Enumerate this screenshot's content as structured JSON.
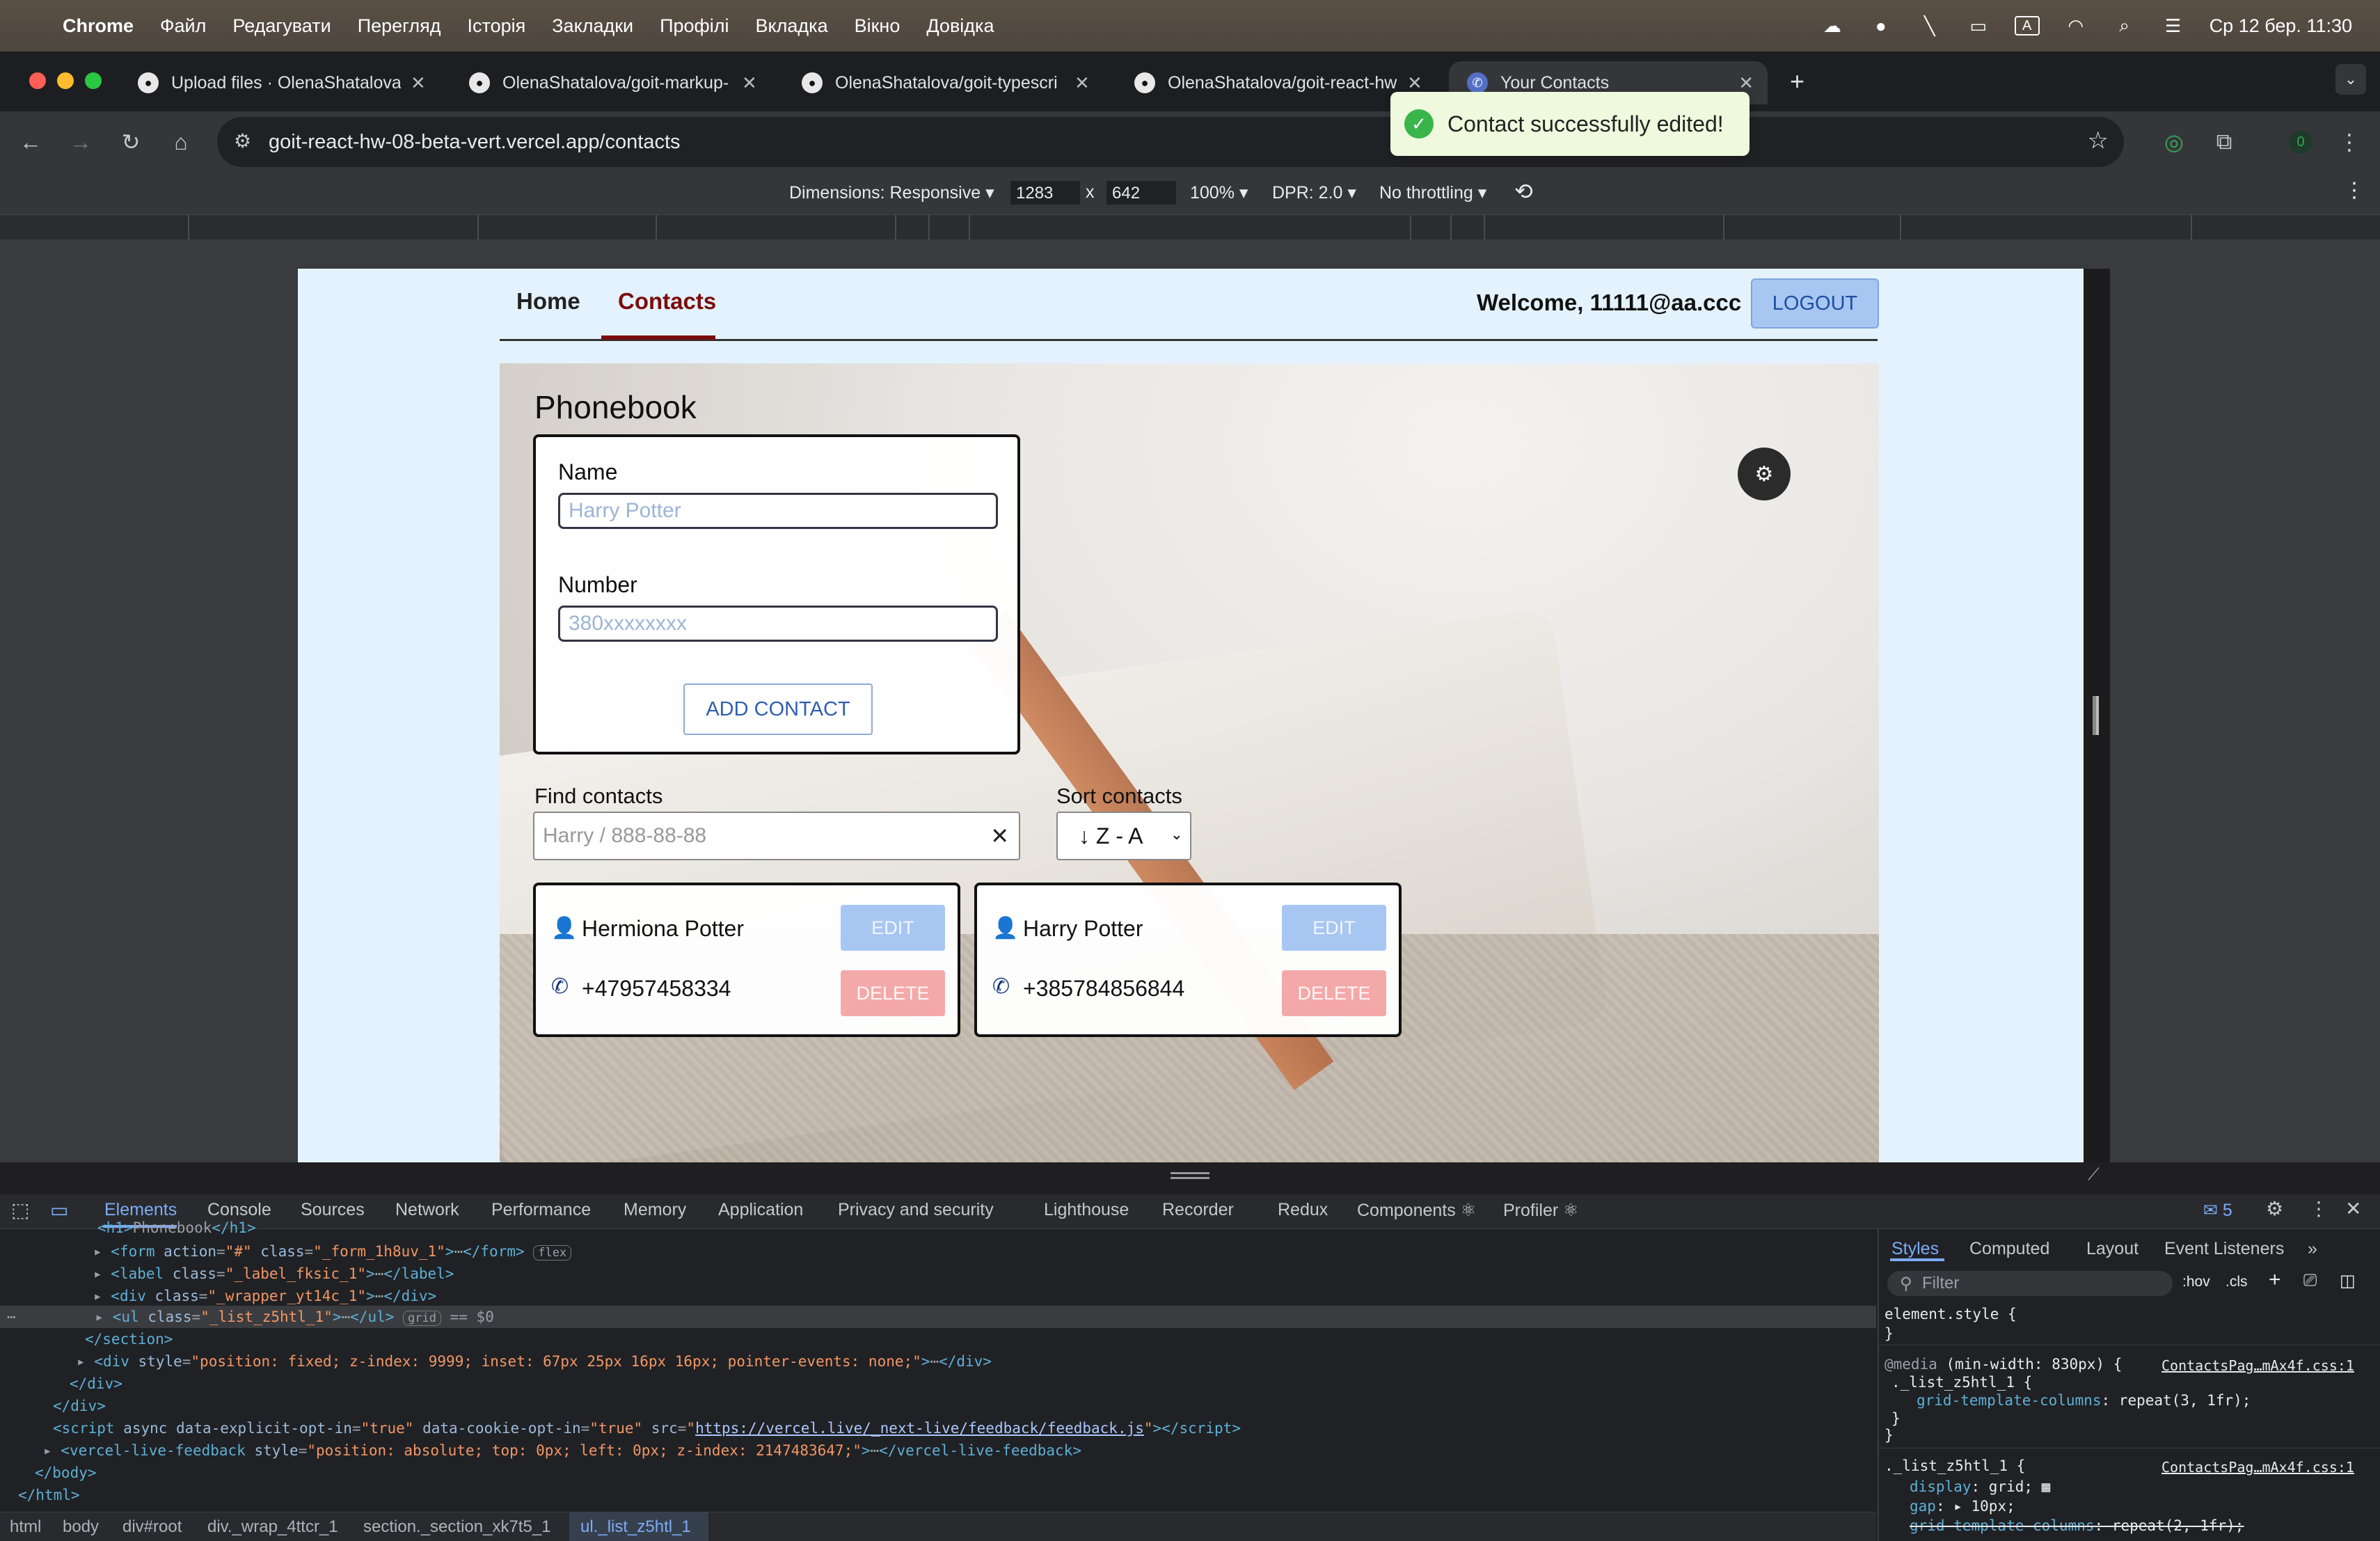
{
  "menubar": {
    "apple": "",
    "app": "Chrome",
    "items": [
      "Файл",
      "Редагувати",
      "Перегляд",
      "Історія",
      "Закладки",
      "Профілі",
      "Вкладка",
      "Вікно",
      "Довідка"
    ],
    "keyboard": "A",
    "datetime": "Ср 12 бер.  11:30"
  },
  "tabs": [
    {
      "title": "Upload files · OlenaShatalova/",
      "icon": "github-icon"
    },
    {
      "title": "OlenaShatalova/goit-markup-",
      "icon": "github-icon"
    },
    {
      "title": "OlenaShatalova/goit-typescri",
      "icon": "github-icon"
    },
    {
      "title": "OlenaShatalova/goit-react-hw",
      "icon": "github-icon"
    },
    {
      "title": "Your Contacts",
      "icon": "phone-icon",
      "active": true
    }
  ],
  "address": {
    "url": "goit-react-hw-08-beta-vert.vercel.app/contacts"
  },
  "extension_badge": "0",
  "device_toolbar": {
    "dimensions_label": "Dimensions: Responsive",
    "width": "1283",
    "times": "x",
    "height": "642",
    "zoom": "100%",
    "dpr": "DPR: 2.0",
    "throttling": "No throttling"
  },
  "app": {
    "nav": {
      "home": "Home",
      "contacts": "Contacts"
    },
    "welcome": "Welcome, 11111@aa.ccc",
    "logout": "LOGOUT",
    "title": "Phonebook",
    "form": {
      "name_label": "Name",
      "name_placeholder": "Harry Potter",
      "number_label": "Number",
      "number_placeholder": "380xxxxxxxx",
      "add_button": "ADD CONTACT"
    },
    "find_label": "Find contacts",
    "find_placeholder": "Harry / 888-88-88",
    "sort_label": "Sort contacts",
    "sort_value": "↓ Z - A",
    "contacts": [
      {
        "name": "Hermiona Potter",
        "number": "+47957458334",
        "edit": "EDIT",
        "delete": "DELETE"
      },
      {
        "name": "Harry Potter",
        "number": "+385784856844",
        "edit": "EDIT",
        "delete": "DELETE"
      }
    ],
    "toast": "Contact successfully edited!"
  },
  "devtools": {
    "tabs": [
      "Elements",
      "Console",
      "Sources",
      "Network",
      "Performance",
      "Memory",
      "Application",
      "Privacy and security",
      "Lighthouse",
      "Recorder",
      "Redux",
      "Components ⚛",
      "Profiler ⚛"
    ],
    "issues_count": "5",
    "breadcrumbs": [
      "html",
      "body",
      "div#root",
      "div._wrap_4ttcr_1",
      "section._section_xk7t5_1",
      "ul._list_z5htl_1"
    ],
    "styles_tabs": [
      "Styles",
      "Computed",
      "Layout",
      "Event Listeners"
    ],
    "filter_placeholder": "Filter",
    "hov": ":hov",
    "cls": ".cls"
  }
}
